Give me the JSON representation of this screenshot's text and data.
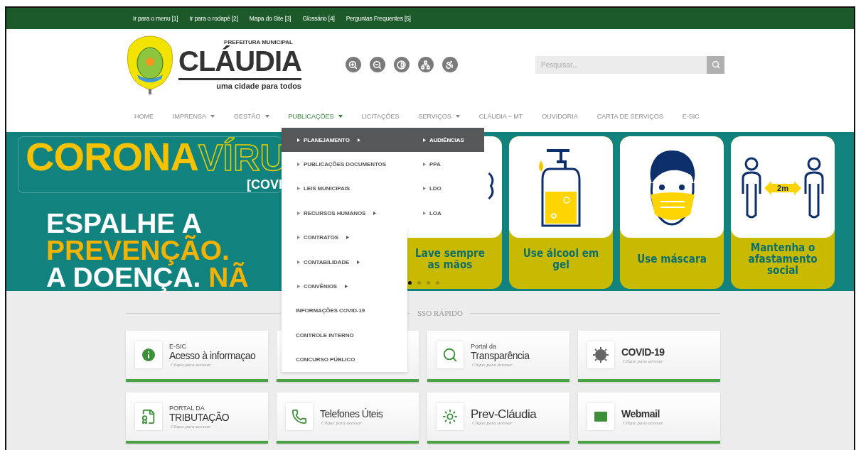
{
  "top_links": [
    "Ir para o menu [1]",
    "Ir para o rodapé [2]",
    "Mapa do Site [3]",
    "Glossário [4]",
    "Perguntas Frequentes [5]"
  ],
  "logo": {
    "overline": "PREFEITURA MUNICIPAL",
    "name": "CLÁUDIA",
    "tagline": "uma cidade para todos"
  },
  "search": {
    "placeholder": "Pesquisar..."
  },
  "nav": [
    {
      "label": "HOME",
      "has_submenu": false,
      "selected": false
    },
    {
      "label": "IMPRENSA",
      "has_submenu": true,
      "selected": false
    },
    {
      "label": "GESTÃO",
      "has_submenu": true,
      "selected": false
    },
    {
      "label": "PUBLICAÇÕES",
      "has_submenu": true,
      "selected": true
    },
    {
      "label": "LICITAÇÕES",
      "has_submenu": false,
      "selected": false
    },
    {
      "label": "SERVIÇOS",
      "has_submenu": true,
      "selected": false
    },
    {
      "label": "CLÁUDIA – MT",
      "has_submenu": false,
      "selected": false
    },
    {
      "label": "OUVIDORIA",
      "has_submenu": false,
      "selected": false
    },
    {
      "label": "CARTA DE SERVIÇOS",
      "has_submenu": false,
      "selected": false
    },
    {
      "label": "E-SIC",
      "has_submenu": false,
      "selected": false
    }
  ],
  "dropdown": [
    {
      "label": "PLANEJAMENTO",
      "kind": "bullet",
      "has_submenu": true,
      "selected": true
    },
    {
      "label": "PUBLICAÇÕES DOCUMENTOS",
      "kind": "bullet",
      "has_submenu": false,
      "selected": false
    },
    {
      "label": "LEIS MUNICIPAIS",
      "kind": "bullet",
      "has_submenu": false,
      "selected": false
    },
    {
      "label": "RECURSOS HUMANOS",
      "kind": "bullet",
      "has_submenu": true,
      "selected": false
    },
    {
      "label": "CONTRATOS",
      "kind": "bullet",
      "has_submenu": true,
      "selected": false
    },
    {
      "label": "CONTABILIDADE",
      "kind": "bullet",
      "has_submenu": true,
      "selected": false
    },
    {
      "label": "CONVÊNIOS",
      "kind": "bullet",
      "has_submenu": true,
      "selected": false
    },
    {
      "label": "INFORMAÇÕES COVID-19",
      "kind": "plain",
      "has_submenu": false,
      "selected": false
    },
    {
      "label": "CONTROLE INTERNO",
      "kind": "plain",
      "has_submenu": false,
      "selected": false
    },
    {
      "label": "CONCURSO PÚBLICO",
      "kind": "plain",
      "has_submenu": false,
      "selected": false
    }
  ],
  "submenu": [
    {
      "label": "AUDIÊNCIAS",
      "selected": true
    },
    {
      "label": "PPA",
      "selected": false
    },
    {
      "label": "LDO",
      "selected": false
    },
    {
      "label": "LOA",
      "selected": false
    }
  ],
  "banner": {
    "title_fill": "CORONA",
    "title_outline": "VÍRU",
    "tag": "[COVI",
    "lines": [
      [
        {
          "text": "ESPALHE A",
          "kind": "white"
        }
      ],
      [
        {
          "text": "PREVENÇÃO.",
          "kind": "yellow"
        }
      ],
      [
        {
          "text": "A DOENÇA. ",
          "kind": "white"
        },
        {
          "text": "NÃ",
          "kind": "yellow"
        }
      ]
    ],
    "cards": [
      {
        "kind": "hands",
        "caption": "Lave sempre as mãos"
      },
      {
        "kind": "gel",
        "caption": "Use álcool em gel"
      },
      {
        "kind": "mask",
        "caption": "Use máscara"
      },
      {
        "kind": "distance",
        "caption": "Mantenha o afastamento social",
        "badge": "2m"
      }
    ],
    "dots": [
      {
        "selected": true
      },
      {
        "selected": false
      },
      {
        "selected": false
      },
      {
        "selected": false
      }
    ]
  },
  "quick_access": {
    "heading": "SSO RÁPIDO",
    "cards": [
      {
        "kind": "info",
        "overline": "E-SIC",
        "title": "Acesso à informaçao",
        "hint": "Clique para acessar"
      },
      {
        "kind": "covered"
      },
      {
        "kind": "transparency",
        "overline": "Portal da",
        "title": "Transparência",
        "hint": "Clique para acessar"
      },
      {
        "kind": "virus",
        "title": "COVID-19",
        "hint": "Clique para acessar"
      },
      {
        "kind": "document",
        "overline": "PORTAL DA",
        "title": "TRIBUTAÇÃO",
        "hint": "Clique para acessar"
      },
      {
        "kind": "phone",
        "title": "Telefones Úteis",
        "hint": "Clique para acessar"
      },
      {
        "kind": "sun",
        "title": "Prev-Cláudia",
        "hint": "Clique para acessar"
      },
      {
        "kind": "mail",
        "title": "Webmail",
        "hint": "Clique para acessar"
      }
    ]
  }
}
